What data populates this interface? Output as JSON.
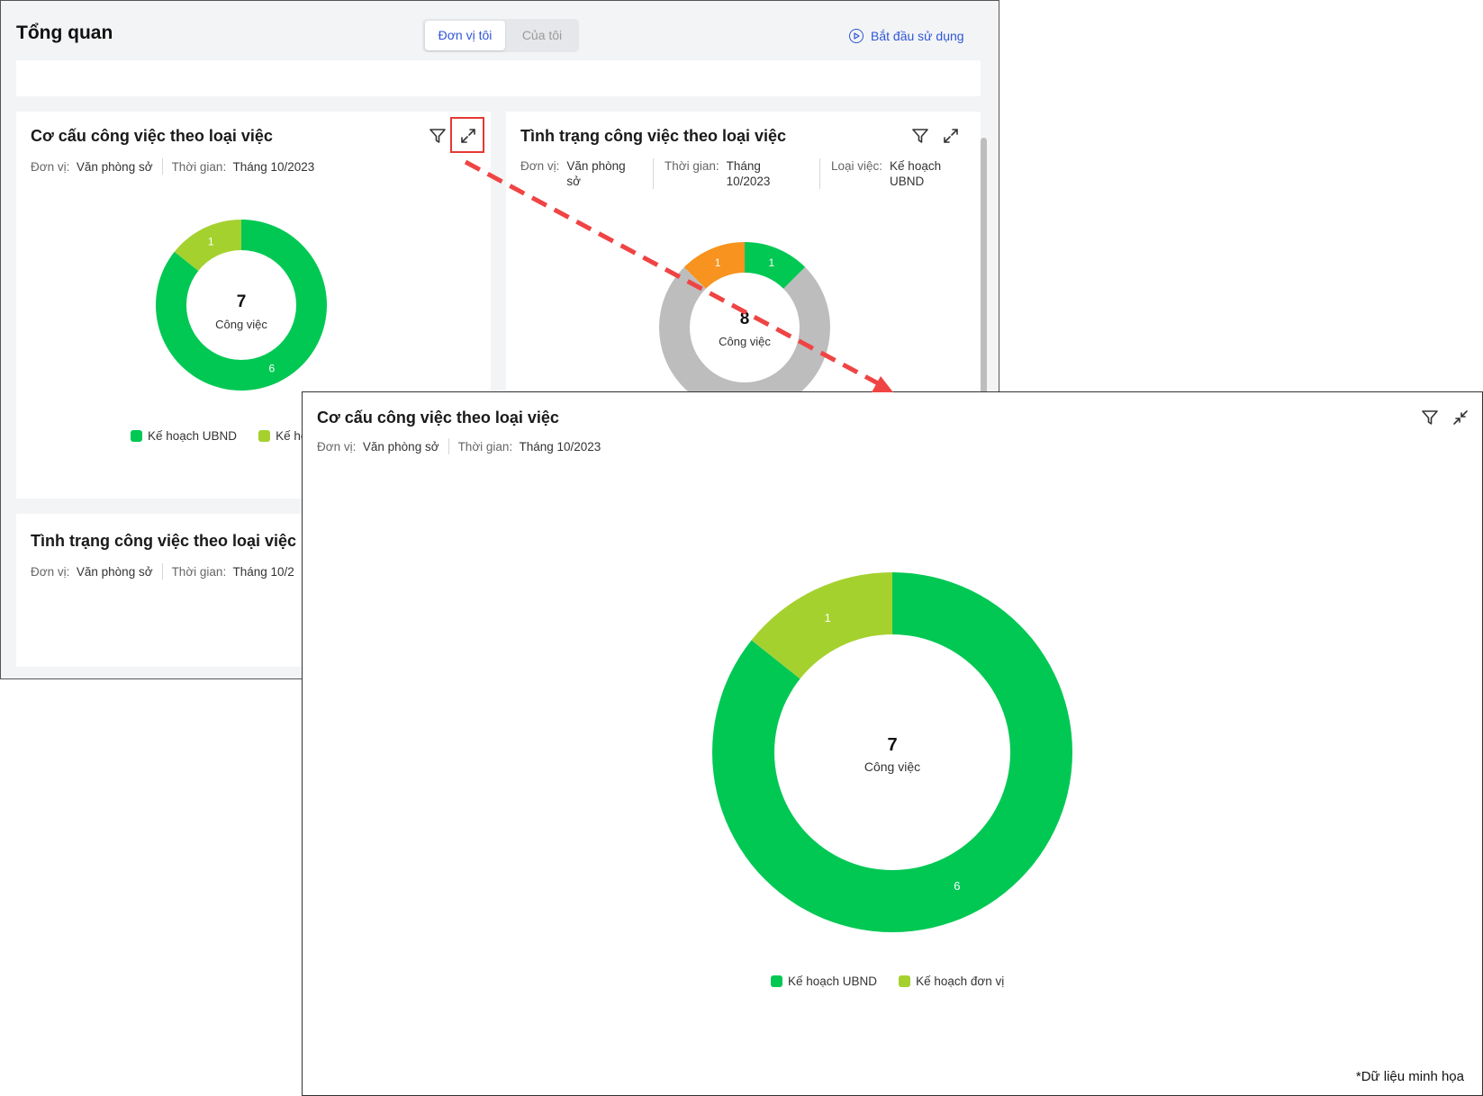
{
  "dashboard": {
    "title": "Tổng quan",
    "tabs": [
      {
        "label": "Đơn vị tôi",
        "active": true
      },
      {
        "label": "Của tôi",
        "active": false
      }
    ],
    "get_started_label": "Bắt đầu sử dụng",
    "cards": [
      {
        "title": "Cơ cấu công việc theo loại việc",
        "meta": [
          {
            "key": "Đơn vị:",
            "value": "Văn phòng sở"
          },
          {
            "key": "Thời gian:",
            "value": "Tháng 10/2023"
          }
        ],
        "center_value": "7",
        "center_label": "Công việc",
        "legend": [
          "Kế hoạch UBND",
          "Kế ho"
        ]
      },
      {
        "title": "Tình trạng công việc theo loại việc",
        "meta": [
          {
            "key": "Đơn vị:",
            "value_line1": "Văn phòng",
            "value_line2": "sở"
          },
          {
            "key": "Thời gian:",
            "value_line1": "Tháng",
            "value_line2": "10/2023"
          },
          {
            "key": "Loại việc:",
            "value_line1": "Kế hoạch",
            "value_line2": "UBND"
          }
        ],
        "center_value": "8",
        "center_label": "Công việc"
      },
      {
        "title": "Tình trạng công việc theo loại việc",
        "meta": [
          {
            "key": "Đơn vị:",
            "value": "Văn phòng sở"
          },
          {
            "key": "Thời gian:",
            "value": "Tháng 10/2"
          }
        ]
      }
    ]
  },
  "expanded": {
    "title": "Cơ cấu công việc theo loại việc",
    "meta": [
      {
        "key": "Đơn vị:",
        "value": "Văn phòng sở"
      },
      {
        "key": "Thời gian:",
        "value": "Tháng 10/2023"
      }
    ],
    "center_value": "7",
    "center_label": "Công việc",
    "footnote": "*Dữ liệu minh họa"
  },
  "icons": [
    "filter-icon",
    "expand-icon",
    "collapse-icon",
    "play-circle-icon"
  ],
  "colors": {
    "accent": "#2f56d6",
    "green": "#00c853",
    "lime": "#a5d12f",
    "orange": "#f7931e",
    "gray": "#bdbdbd",
    "arrow": "#f04444"
  },
  "chart_data": [
    {
      "type": "pie",
      "title": "Cơ cấu công việc theo loại việc",
      "categories": [
        "Kế hoạch UBND",
        "Kế hoạch đơn vị"
      ],
      "values": [
        6,
        1
      ],
      "total": 7,
      "colors": [
        "#00c853",
        "#a5d12f"
      ]
    },
    {
      "type": "pie",
      "title": "Tình trạng công việc theo loại việc",
      "values_shown": [
        1,
        1
      ],
      "total": 8,
      "colors": [
        "#00c853",
        "#f7931e",
        "#bdbdbd"
      ]
    }
  ]
}
